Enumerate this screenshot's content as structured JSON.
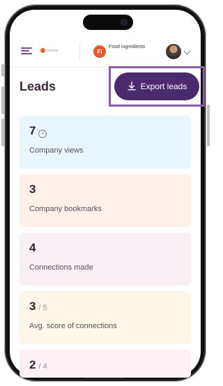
{
  "header": {
    "brand_text": "Food ingredients",
    "brand_logo_letters": "Fi"
  },
  "leads": {
    "title": "Leads",
    "export_label": "Export leads"
  },
  "cards": [
    {
      "value": "7",
      "denominator": "",
      "label": "Company views",
      "bg": "#e9f6fd",
      "info": true
    },
    {
      "value": "3",
      "denominator": "",
      "label": "Company bookmarks",
      "bg": "#fff1ea",
      "info": false
    },
    {
      "value": "4",
      "denominator": "",
      "label": "Connections made",
      "bg": "#f8f0f4",
      "info": false
    },
    {
      "value": "3",
      "denominator": "/ 5",
      "label": "Avg. score of connections",
      "bg": "#fff6ea",
      "info": false
    },
    {
      "value": "2",
      "denominator": "/ 4",
      "label": "",
      "bg": "#fdf1f6",
      "info": false
    }
  ],
  "colors": {
    "primary": "#4a2a6d",
    "accent": "#8b5fa6",
    "brand_orange": "#e35a2a"
  },
  "icons": {
    "menu": "hamburger-icon",
    "export": "download-icon",
    "info": "info-icon",
    "dropdown": "chevron-down-icon"
  }
}
